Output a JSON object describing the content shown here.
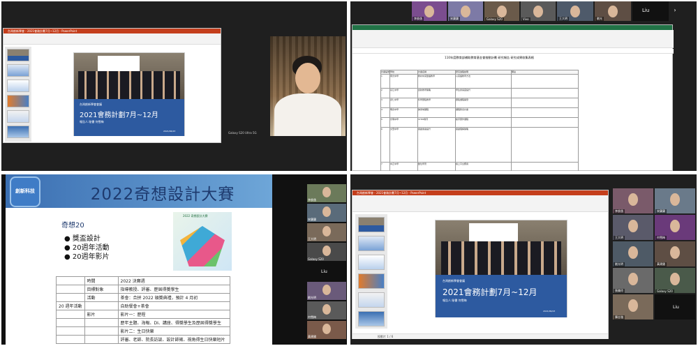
{
  "top_left": {
    "ppt_title": "台灣創新學會 - 2021會務計劃7月~12月 - PowerPoint",
    "slide_small": "台灣創新學會會議",
    "slide_title": "2021會務計劃7月~12月",
    "slide_sub": "報告人:秘書 何雪梅",
    "slide_date": "2021/06/23",
    "cam_label": "Galaxy S20 Ultra 5G"
  },
  "top_right": {
    "sheet_title": "110年度教育部補助教育基金會推動計劃 研究報告 研究成果收集表格",
    "header_cols": [
      "計畫編號",
      "學校",
      "計畫名稱",
      "研究過程說明",
      "備註"
    ],
    "rows": [
      [
        "1",
        "南光中學",
        "教材中英雙語教學",
        "以英語教學方法"
      ],
      [
        "2",
        "基江中學",
        "創新教學策略",
        "學生參與度提升"
      ],
      [
        "3",
        "德仁中學",
        "科學實驗教學",
        "實驗課程開發"
      ],
      [
        "4",
        "明德中學",
        "跨領域課程",
        "課程整合計畫"
      ],
      [
        "5",
        "光明中學",
        "STEM教育",
        "動手實作課程"
      ],
      [
        "6",
        "文華中學",
        "閱讀素養提升",
        "閱讀理解策略"
      ],
      [
        "7",
        "中正中學",
        "數位學習",
        "線上平台應用"
      ]
    ],
    "participants": [
      "李俊逸",
      "宋蘭蘭",
      "Galaxy S20",
      "Vivo",
      "王大明",
      "劉光",
      "Liu"
    ],
    "liu_label": "Liu"
  },
  "bottom_left": {
    "logo_text": "創新科技",
    "title": "2022奇想設計大賽",
    "subtitle": "奇想20",
    "bullets": [
      "獎盃設計",
      "20週年活動",
      "20週年影片"
    ],
    "logo_caption": "2022 奇想設計大賽",
    "table": [
      {
        "col1": "",
        "col2": "時間",
        "col3": "2022 決賽週"
      },
      {
        "col1": "",
        "col2": "目標對象",
        "col3": "指導教授、評審、歷屆得獎學生"
      },
      {
        "col1": "",
        "col2": "活動",
        "col3": "茶會：合拼 2022 頒獎典禮，預計 4 月初"
      },
      {
        "col1": "20 週年活動",
        "col2": "",
        "col3": "自助餐會+茶會"
      },
      {
        "col1": "",
        "col2": "影片",
        "col3": "影片一：歷程"
      },
      {
        "col1": "",
        "col2": "",
        "col3": "歷年主題、海報、DI、講座、得獎學生及歷屆得獎學生"
      },
      {
        "col1": "",
        "col2": "",
        "col3": "影片二：生日快樂"
      },
      {
        "col1": "",
        "col2": "",
        "col3": "評審、老師、院長訪談、設計師徵、視角得生日快樂短片"
      }
    ],
    "side_names": [
      "李俊逸",
      "宋蘭蘭",
      "王大明",
      "Galaxy S20",
      "Liu",
      "劉光明",
      "何雪梅",
      "黃建國"
    ]
  },
  "bottom_right": {
    "ppt_title": "台灣創新學會 - 2021會務計劃7月~12月 - PowerPoint",
    "slide_small": "台灣創新學會會議",
    "slide_title": "2021會務計劃7月~12月",
    "slide_sub": "報告人:秘書 何雪梅",
    "slide_date": "2021/06/23",
    "status": "投影片 1 / 6",
    "participants": [
      "李俊逸",
      "宋蘭蘭",
      "王大明",
      "何雪梅",
      "劉光明",
      "黃建國",
      "張美玲",
      "Galaxy S20",
      "陳志強",
      "Liu"
    ],
    "liu_label": "Liu"
  }
}
